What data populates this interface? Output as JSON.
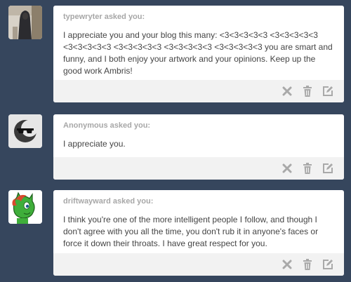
{
  "asks": [
    {
      "asker": "typewryter",
      "asked_suffix": " asked you:",
      "question": "I appreciate you and your blog this many: <3<3<3<3<3 <3<3<3<3<3 <3<3<3<3<3 <3<3<3<3<3 <3<3<3<3<3 <3<3<3<3<3 you are smart and funny, and I both enjoy your artwork and your opinions. Keep up the good work Ambris!",
      "avatar_icon": "hooded-figure-photo",
      "actions": [
        "delete-x-icon",
        "trash-icon",
        "edit-icon"
      ]
    },
    {
      "asker": "Anonymous",
      "asked_suffix": " asked you:",
      "question": "I appreciate you.",
      "avatar_icon": "anonymous-sunglasses-icon",
      "actions": [
        "delete-x-icon",
        "trash-icon",
        "edit-icon"
      ]
    },
    {
      "asker": "driftwayward",
      "asked_suffix": " asked you:",
      "question": "I think you're one of the more intelligent people I follow, and though I don't agree with you all the time, you don't rub it in anyone's faces or force it down their throats. I have great respect for you.",
      "avatar_icon": "green-pony-avatar",
      "actions": [
        "delete-x-icon",
        "trash-icon",
        "edit-icon"
      ]
    }
  ],
  "colors": {
    "background": "#36465d",
    "card": "#ffffff",
    "footer": "#f2f2f2",
    "asker_text": "#a7a7a7",
    "body_text": "#444444",
    "action_icon": "#a9a9a9"
  }
}
